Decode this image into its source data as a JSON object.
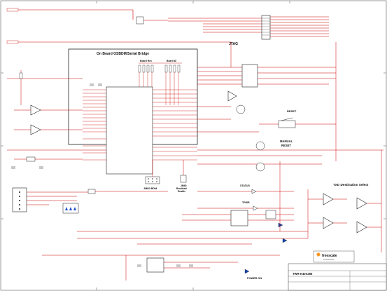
{
  "diagram": {
    "blocks": {
      "osbdm_title": "On Board OSBDM/Serial Bridge",
      "jtag_title": "JTAG",
      "reset_title": "RESET",
      "manual_reset_title": "MANUAL\nRESET",
      "txd_select_title": "TXD Destination Select",
      "status_title": "STATUS",
      "tpwr_title": "TPWR",
      "jm60_bdm_title": "JM60 BDM",
      "jm60_bootload_title": "JM60\nBootload\nEnable",
      "power_on_title": "POWER ON",
      "board_rev_title": "Board Rev",
      "board_id_title": "Board ID"
    },
    "title_block": {
      "company": "freescale",
      "subtitle": "semiconductor",
      "board": "TWR-K40X256"
    },
    "colors": {
      "wire": "#cc0000",
      "part": "#222222",
      "net_label": "#2a8a2a",
      "logo": "#f7941d"
    }
  }
}
